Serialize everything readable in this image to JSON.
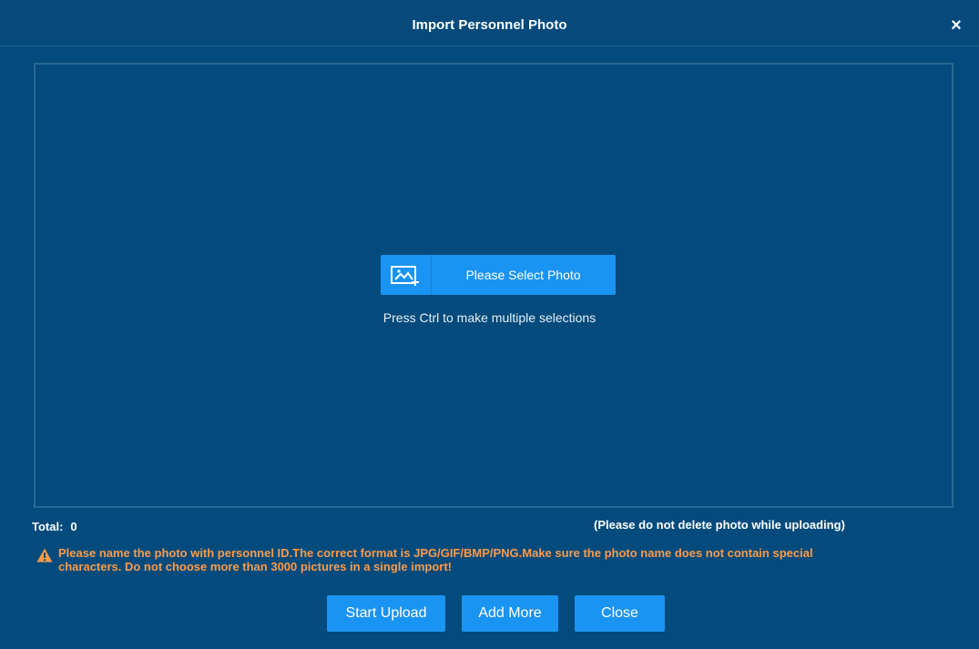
{
  "dialog": {
    "title": "Import Personnel Photo",
    "close_icon": "×"
  },
  "dropzone": {
    "select_button_label": "Please Select Photo",
    "select_icon": "image-add-icon",
    "hint": "Press Ctrl to make multiple selections"
  },
  "status": {
    "total_label": "Total:",
    "total_value": "0",
    "upload_note": "(Please do not delete photo while uploading)"
  },
  "warning": {
    "icon": "warning-icon",
    "line1": "Please name the photo with personnel ID.The correct format is JPG/GIF/BMP/PNG.Make sure the photo name does not contain special",
    "line2": "characters. Do not choose more than 3000 pictures in a single import!",
    "color": "#ff9a4a"
  },
  "buttons": {
    "start_upload": "Start Upload",
    "add_more": "Add More",
    "close": "Close"
  },
  "colors": {
    "background": "#024b7c",
    "accent": "#1a94f2"
  }
}
